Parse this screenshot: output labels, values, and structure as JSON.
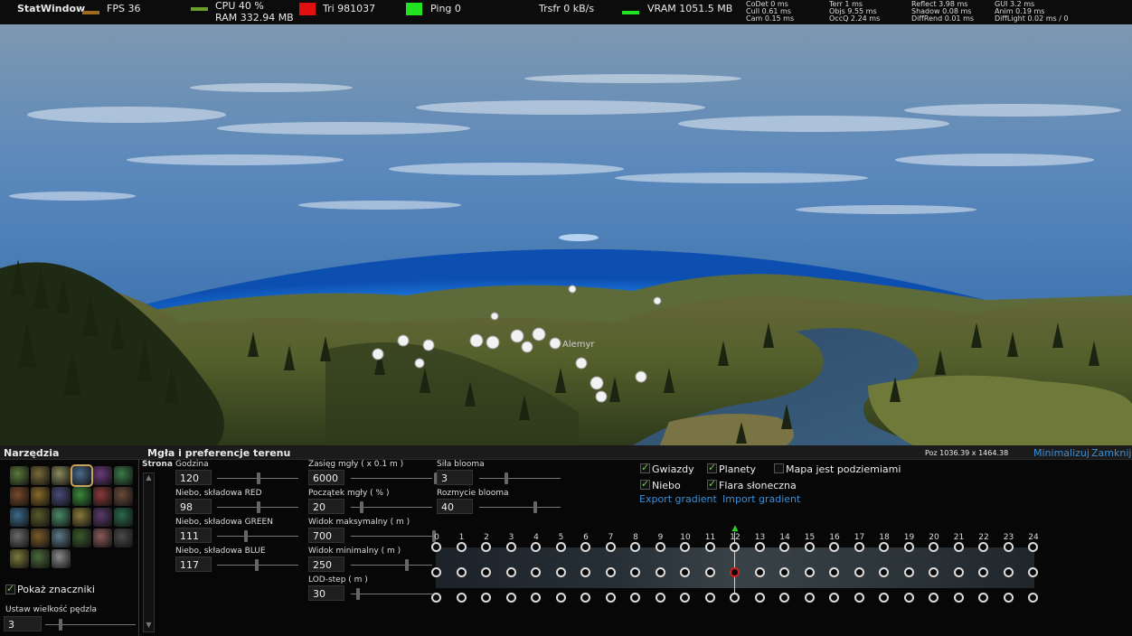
{
  "statbar": {
    "title": "StatWindow",
    "fps": "FPS 36",
    "cpu": "CPU 40 %",
    "ram": "RAM 332.94 MB",
    "tri": "Tri 981037",
    "ping": "Ping 0",
    "trsfr": "Trsfr 0 kB/s",
    "vram": "VRAM 1051.5 MB",
    "timings": [
      [
        "CoDet 0 ms",
        "Cull 0.61 ms",
        "Cam 0.15 ms"
      ],
      [
        "Terr 1 ms",
        "Objs 9.55 ms",
        "OccQ 2.24 ms"
      ],
      [
        "Reflect 3.98 ms",
        "Shadow 0.08 ms",
        "DiffRend 0.01 ms"
      ],
      [
        "GUI 3.2 ms",
        "Anim 0.19 ms",
        "DiffLight 0.02 ms / 0"
      ]
    ],
    "colors": {
      "fps": "#a06a1e",
      "cpu": "#6aa02a",
      "tri": "#e01010",
      "ping": "#22e022",
      "vram": "#22e022"
    }
  },
  "scene": {
    "label": "Alemyr"
  },
  "panel": {
    "tools_title": "Narzędzia",
    "settings_title": "Mgła i preferencje terenu",
    "position": "Poz 1036.39 x 1464.38",
    "minimize": "Minimalizuj",
    "close": "Zamknij",
    "show_markers": "Pokaż znaczniki",
    "brush_label": "Ustaw wielkość pędzla",
    "brush_value": "3",
    "page_label": "Strona",
    "col1": [
      {
        "label": "Godzina",
        "value": "120"
      },
      {
        "label": "Niebo, składowa RED",
        "value": "98"
      },
      {
        "label": "Niebo, składowa GREEN",
        "value": "111"
      },
      {
        "label": "Niebo, składowa BLUE",
        "value": "117"
      }
    ],
    "col2": [
      {
        "label": "Zasięg mgły  ( x 0.1 m )",
        "value": "6000"
      },
      {
        "label": "Początek mgły  ( % )",
        "value": "20"
      },
      {
        "label": "Widok maksymalny  ( m )",
        "value": "700"
      },
      {
        "label": "Widok minimalny  ( m )",
        "value": "250"
      },
      {
        "label": "LOD-step  ( m )",
        "value": "30"
      }
    ],
    "col3": [
      {
        "label": "Siła blooma",
        "value": "3"
      },
      {
        "label": "Rozmycie blooma",
        "value": "40"
      }
    ],
    "checks": {
      "stars": "Gwiazdy",
      "planets": "Planety",
      "underground": "Mapa jest podziemiami",
      "sky": "Niebo",
      "flare": "Flara słoneczna"
    },
    "export_gradient": "Export gradient",
    "import_gradient": "Import gradient",
    "hours": [
      "0",
      "1",
      "2",
      "3",
      "4",
      "5",
      "6",
      "7",
      "8",
      "9",
      "10",
      "11",
      "12",
      "13",
      "14",
      "15",
      "16",
      "17",
      "18",
      "19",
      "20",
      "21",
      "22",
      "23",
      "24"
    ]
  }
}
